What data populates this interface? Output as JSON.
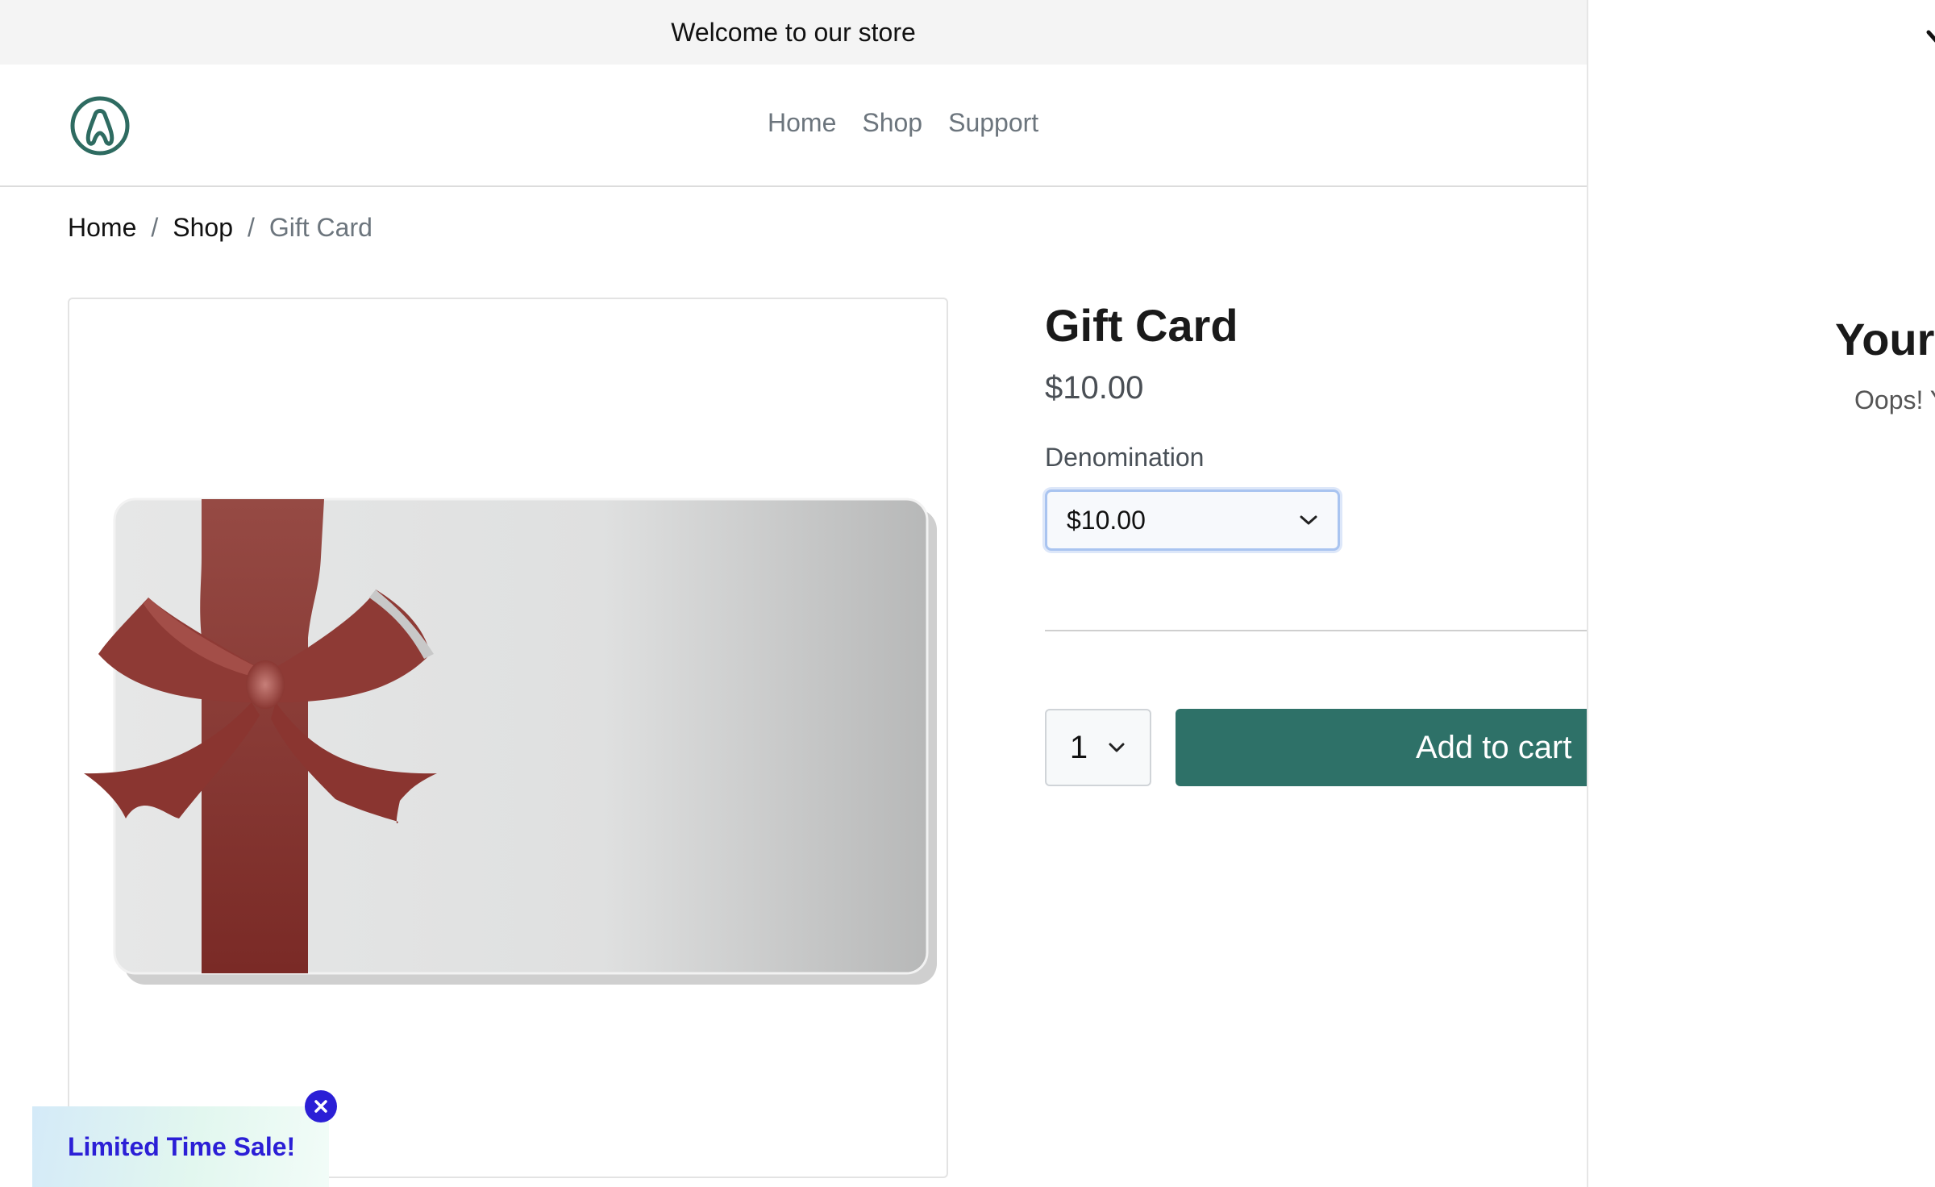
{
  "announcement": "Welcome to our store",
  "nav": {
    "logo": "logo-icon",
    "links": [
      "Home",
      "Shop",
      "Support"
    ]
  },
  "breadcrumb": {
    "items": [
      "Home",
      "Shop"
    ],
    "separator": "/",
    "current": "Gift Card"
  },
  "product": {
    "title": "Gift Card",
    "price": "$10.00",
    "image": "gift-card-image",
    "variant_label": "Denomination",
    "variant_selected": "$10.00",
    "quantity": "1",
    "add_to_cart": "Add to cart"
  },
  "promo": {
    "text": "Limited Time Sale!",
    "close_icon": "close-icon"
  },
  "cart_drawer": {
    "title": "Your",
    "message": "Oops! Y",
    "close_icon": "close-icon"
  },
  "colors": {
    "accent": "#2e7168",
    "announcement_bg": "#f4f4f4",
    "promo_text": "#2b1fd6",
    "ribbon": "#8e3a35"
  }
}
